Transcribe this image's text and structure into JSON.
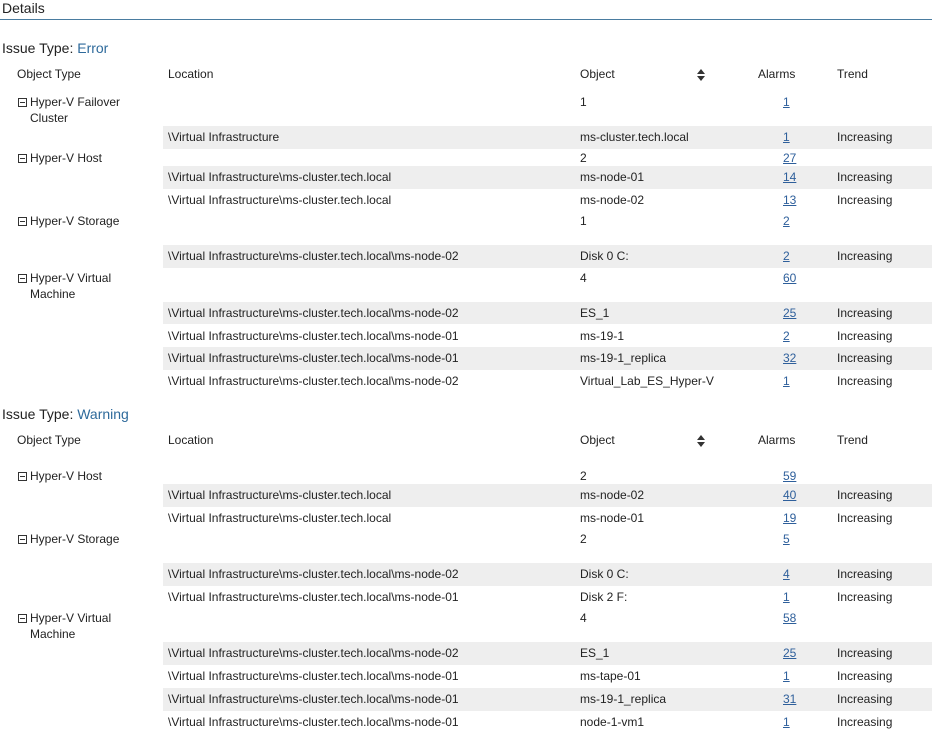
{
  "page": {
    "title": "Details"
  },
  "columns": {
    "object_type": "Object Type",
    "location": "Location",
    "object": "Object",
    "alarms": "Alarms",
    "trend": "Trend"
  },
  "sections": [
    {
      "label": "Issue Type: ",
      "type": "Error",
      "groups": [
        {
          "name": "Hyper-V Failover Cluster",
          "count": "1",
          "alarms": "1",
          "items": [
            {
              "location": "\\Virtual Infrastructure",
              "object": "ms-cluster.tech.local",
              "alarms": "1",
              "trend": "Increasing"
            }
          ]
        },
        {
          "name": "Hyper-V Host",
          "count": "2",
          "alarms": "27",
          "items": [
            {
              "location": "\\Virtual Infrastructure\\ms-cluster.tech.local",
              "object": "ms-node-01",
              "alarms": "14",
              "trend": "Increasing"
            },
            {
              "location": "\\Virtual Infrastructure\\ms-cluster.tech.local",
              "object": "ms-node-02",
              "alarms": "13",
              "trend": "Increasing"
            }
          ]
        },
        {
          "name": "Hyper-V Storage",
          "count": "1",
          "alarms": "2",
          "items": [
            {
              "location": "\\Virtual Infrastructure\\ms-cluster.tech.local\\ms-node-02",
              "object": "Disk 0  C:",
              "alarms": "2",
              "trend": "Increasing"
            }
          ]
        },
        {
          "name": "Hyper-V Virtual Machine",
          "count": "4",
          "alarms": "60",
          "items": [
            {
              "location": "\\Virtual Infrastructure\\ms-cluster.tech.local\\ms-node-02",
              "object": "ES_1",
              "alarms": "25",
              "trend": "Increasing"
            },
            {
              "location": "\\Virtual Infrastructure\\ms-cluster.tech.local\\ms-node-01",
              "object": "ms-19-1",
              "alarms": "2",
              "trend": "Increasing"
            },
            {
              "location": "\\Virtual Infrastructure\\ms-cluster.tech.local\\ms-node-01",
              "object": "ms-19-1_replica",
              "alarms": "32",
              "trend": "Increasing"
            },
            {
              "location": "\\Virtual Infrastructure\\ms-cluster.tech.local\\ms-node-02",
              "object": "Virtual_Lab_ES_Hyper-V",
              "alarms": "1",
              "trend": "Increasing"
            }
          ]
        }
      ]
    },
    {
      "label": "Issue Type: ",
      "type": "Warning",
      "groups": [
        {
          "name": "Hyper-V Host",
          "count": "2",
          "alarms": "59",
          "items": [
            {
              "location": "\\Virtual Infrastructure\\ms-cluster.tech.local",
              "object": "ms-node-02",
              "alarms": "40",
              "trend": "Increasing"
            },
            {
              "location": "\\Virtual Infrastructure\\ms-cluster.tech.local",
              "object": "ms-node-01",
              "alarms": "19",
              "trend": "Increasing"
            }
          ]
        },
        {
          "name": "Hyper-V Storage",
          "count": "2",
          "alarms": "5",
          "items": [
            {
              "location": "\\Virtual Infrastructure\\ms-cluster.tech.local\\ms-node-02",
              "object": "Disk 0  C:",
              "alarms": "4",
              "trend": "Increasing"
            },
            {
              "location": "\\Virtual Infrastructure\\ms-cluster.tech.local\\ms-node-01",
              "object": "Disk 2  F:",
              "alarms": "1",
              "trend": "Increasing"
            }
          ]
        },
        {
          "name": "Hyper-V Virtual Machine",
          "count": "4",
          "alarms": "58",
          "items": [
            {
              "location": "\\Virtual Infrastructure\\ms-cluster.tech.local\\ms-node-02",
              "object": "ES_1",
              "alarms": "25",
              "trend": "Increasing"
            },
            {
              "location": "\\Virtual Infrastructure\\ms-cluster.tech.local\\ms-node-01",
              "object": "ms-tape-01",
              "alarms": "1",
              "trend": "Increasing"
            },
            {
              "location": "\\Virtual Infrastructure\\ms-cluster.tech.local\\ms-node-01",
              "object": "ms-19-1_replica",
              "alarms": "31",
              "trend": "Increasing"
            },
            {
              "location": "\\Virtual Infrastructure\\ms-cluster.tech.local\\ms-node-01",
              "object": "node-1-vm1",
              "alarms": "1",
              "trend": "Increasing"
            }
          ]
        }
      ]
    }
  ]
}
